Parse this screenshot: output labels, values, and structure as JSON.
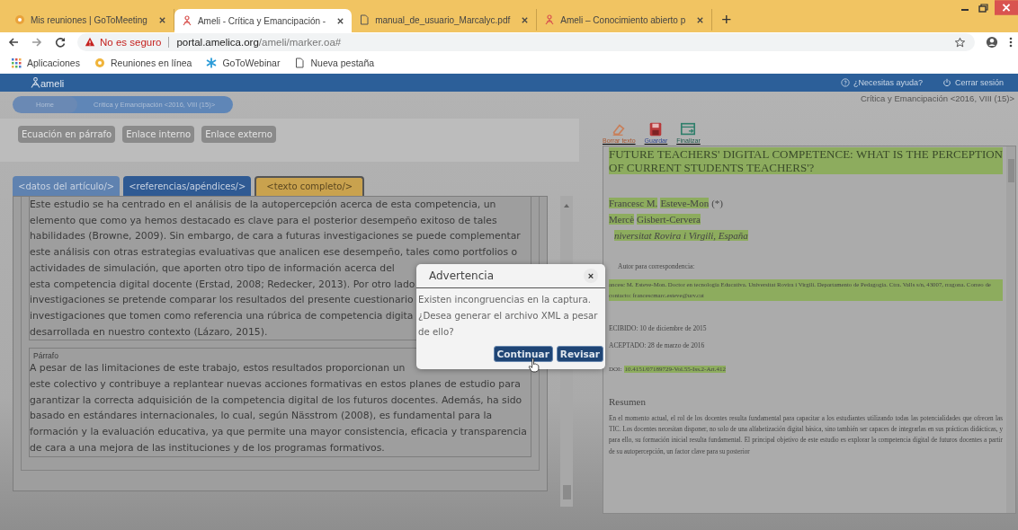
{
  "browser": {
    "tabs": [
      {
        "title": "Mis reuniones | GoToMeeting",
        "selected": false
      },
      {
        "title": "Ameli - Crítica y Emancipación -",
        "selected": true
      },
      {
        "title": "manual_de_usuario_Marcalyc.pdf",
        "selected": false
      },
      {
        "title": "Ameli – Conocimiento abierto p",
        "selected": false
      }
    ],
    "new_tab": "+",
    "address": {
      "security": "No es seguro",
      "host": "portal.amelica.org",
      "path": "/ameli/marker.oa#"
    },
    "bookmarks": [
      "Aplicaciones",
      "Reuniones en línea",
      "GoToWebinar",
      "Nueva pestaña"
    ]
  },
  "app": {
    "logo": "ameli",
    "header_links": [
      "¿Necesitas ayuda?",
      "Cerrar sesión"
    ],
    "breadcrumb": [
      "Home",
      "Crítica y Emancipación <2016, VIII (15)>"
    ],
    "doc_title": "Crítica y Emancipación <2016, VIII (15)>",
    "toolbar_buttons": [
      {
        "label": "Ecuación en párrafo",
        "disabled": true
      },
      {
        "label": "Enlace interno",
        "disabled": true
      },
      {
        "label": "Enlace externo",
        "disabled": true
      }
    ],
    "editor_tabs": [
      {
        "label": "<datos del artículo/>",
        "selected": false,
        "color": "#5f82b0"
      },
      {
        "label": "<referencias/apéndices/>",
        "selected": false,
        "color": "#2f5a93"
      },
      {
        "label": "<texto completo/>",
        "selected": true,
        "color": "#c9a24e"
      }
    ],
    "paragraphs": [
      {
        "lines": [
          "Este estudio se ha centrado en el análisis de la autopercepción acerca de esta competencia, un",
          "elemento que como ya hemos destacado es clave para el posterior desempeño exitoso de tales",
          "habilidades (Browne, 2009). Sin embargo, de cara a futuras investigaciones se puede complementar",
          "este análisis con otras estrategias evaluativas que analicen ese desempeño, tales como portfolios o",
          "actividades de simulación, que aporten otro tipo de información acerca del",
          "esta competencia digital docente (Erstad, 2008; Redecker, 2013). Por otro lado",
          "investigaciones se pretende comparar los resultados del presente cuestionario",
          "investigaciones que tomen como referencia una rúbrica de competencia digita",
          "desarrollada en nuestro contexto (Lázaro, 2015)."
        ]
      },
      {
        "label": "Párrafo",
        "lines": [
          "A pesar de las limitaciones de este trabajo, estos resultados proporcionan un",
          "este colectivo y contribuye a replantear nuevas acciones formativas en estos planes de estudio para",
          "garantizar la correcta adquisición de la competencia digital de los futuros docentes. Además, ha sido",
          "basado en estándares internacionales, lo cual, según Nässtrom (2008), es fundamental para la",
          "formación y la evaluación educativa, ya que permite una mayor consistencia, eficacia y transparencia",
          "de cara a una mejora de las instituciones y de los programas formativos."
        ]
      }
    ],
    "doc_tools": [
      "Borrar texto",
      "Guardar",
      "Finalizar"
    ],
    "document": [
      {
        "kind": "heading",
        "parts": [
          {
            "text": "FUTURE TEACHERS' DIGITAL COMPETENCE: WHAT IS THE PERCEPTION OF CURRENT STUDENTS TEACHERS'?",
            "highlighted": true
          }
        ]
      },
      {
        "kind": "author",
        "parts": [
          {
            "text": "Francesc M.",
            "highlighted": true
          },
          {
            "text": "Esteve-Mon",
            "highlighted": true
          },
          {
            "text": "(*)",
            "highlighted": false
          }
        ]
      },
      {
        "kind": "author",
        "parts": [
          {
            "text": "Mercè",
            "highlighted": true
          },
          {
            "text": "Gisbert-Cervera",
            "highlighted": true
          }
        ]
      },
      {
        "kind": "affiliation",
        "parts": [
          {
            "text": "niversitat Rovira i Virgili, España",
            "highlighted": true
          }
        ]
      },
      {
        "kind": "note",
        "parts": [
          {
            "text": "Autor para correspondencia:",
            "highlighted": false
          }
        ]
      },
      {
        "kind": "small",
        "parts": [
          {
            "text": "ancesc M. Esteve-Mon. Doctor en tecnología Educativa. Universitat Rovira i Virgili. Departamento de Pedagogía. Ctra. Valls s/n, 43007, rragona. Correo de contacto: francescmarc.esteve@urv.cat",
            "highlighted": true
          }
        ]
      },
      {
        "kind": "date",
        "parts": [
          {
            "text": "ECIBIDO: 10 de diciembre de 2015",
            "highlighted": false
          }
        ]
      },
      {
        "kind": "date",
        "parts": [
          {
            "text": "ACEPTADO: 28 de marzo de 2016",
            "highlighted": false
          }
        ]
      },
      {
        "kind": "doi",
        "parts": [
          {
            "text": "DOI:",
            "highlighted": false
          },
          {
            "text": "10.4151/07189729-Vol.55-Iss.2-Art.412",
            "highlighted": true
          }
        ]
      },
      {
        "kind": "section",
        "parts": [
          {
            "text": "Resumen",
            "highlighted": false
          }
        ]
      },
      {
        "kind": "body",
        "parts": [
          {
            "text": "En el momento actual, el rol de los docentes resulta fundamental para capacitar a los estudiantes utilizando todas las potencialidades que ofrecen las TIC. Los docentes necesitan disponer, no solo de una alfabetización digital básica, sino también ser capaces de integrarlas en sus prácticas didácticas, y para ello, su formación inicial resulta fundamental. El principal objetivo de este estudio es explorar la competencia digital de futuros docentes a partir de su autopercepción, un factor clave para su posterior",
            "highlighted": false
          }
        ]
      }
    ]
  },
  "dialog": {
    "title": "Advertencia",
    "close": "×",
    "message": "Existen incongruencias en la captura. ¿Desea generar el archivo XML a pesar de ello?",
    "buttons": [
      "Continuar",
      "Revisar"
    ]
  }
}
